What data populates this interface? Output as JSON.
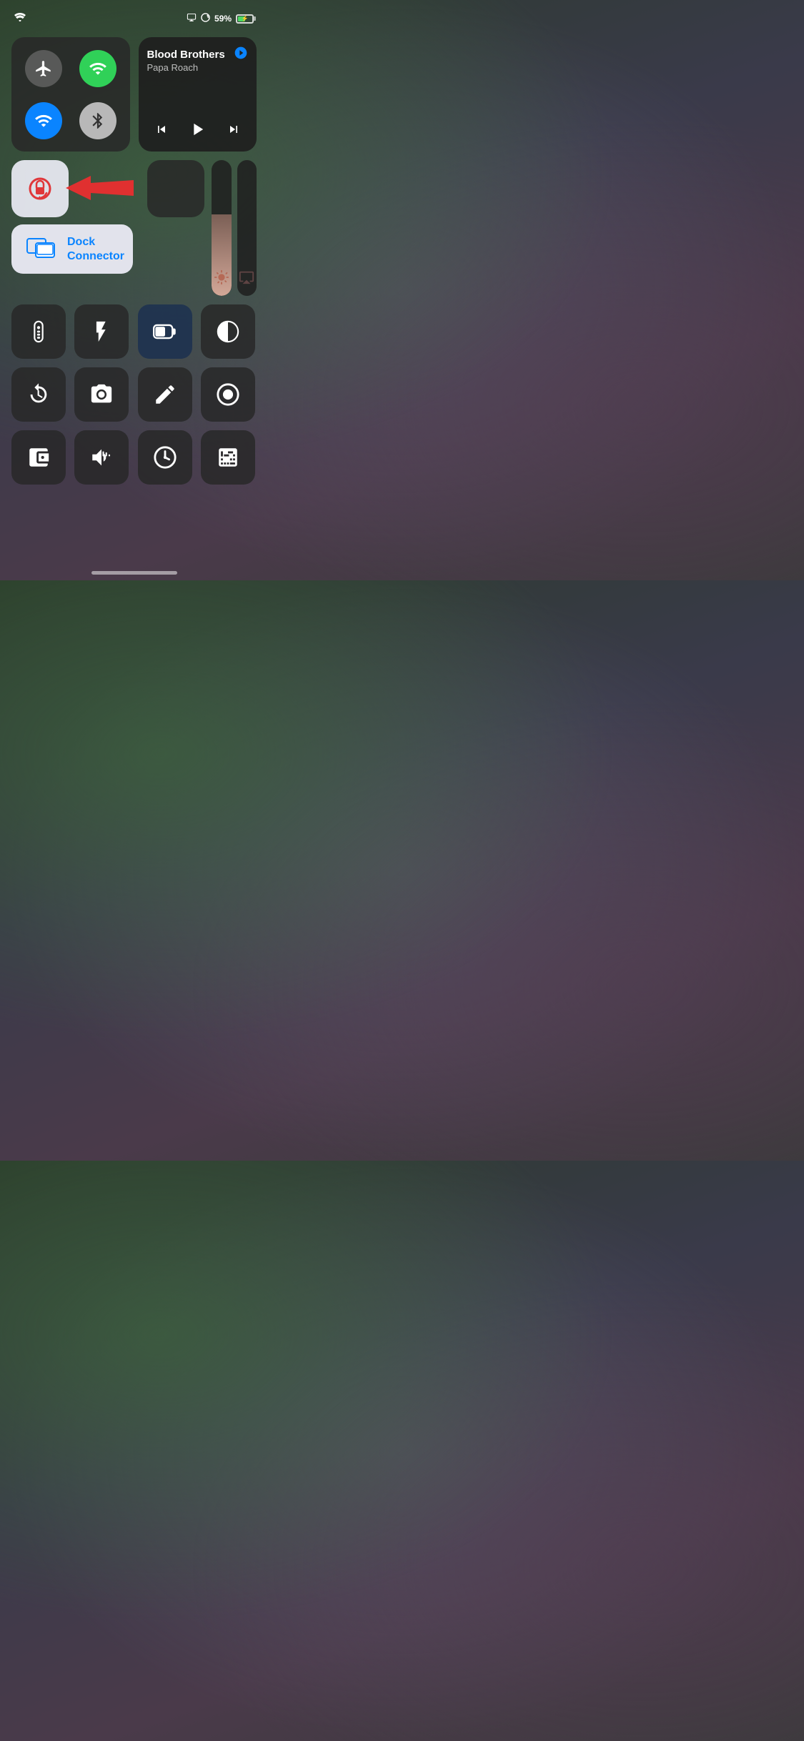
{
  "statusBar": {
    "battery": "59%",
    "batteryPercent": 59
  },
  "connectivity": {
    "airplane": "Airplane Mode",
    "cellular": "Cellular Data",
    "wifi": "Wi-Fi",
    "bluetooth": "Bluetooth"
  },
  "music": {
    "title": "Blood Brothers",
    "artist": "Papa Roach",
    "airplay": "AirPlay"
  },
  "controls": {
    "portraitLock": "Portrait Orientation Lock",
    "brightness": "Brightness",
    "airplay": "Screen Mirroring",
    "dockConnector": "Dock Connector"
  },
  "grid1": {
    "remote": "Apple TV Remote",
    "flashlight": "Flashlight",
    "lowPower": "Low Power Mode",
    "darkMode": "Dark Mode"
  },
  "grid2": {
    "timer": "Timer",
    "camera": "Camera",
    "edit": "Edit",
    "record": "Screen Record"
  },
  "grid3": {
    "wallet": "Wallet",
    "soundRecog": "Sound Recognition",
    "clock": "Clock",
    "calculator": "Calculator"
  }
}
